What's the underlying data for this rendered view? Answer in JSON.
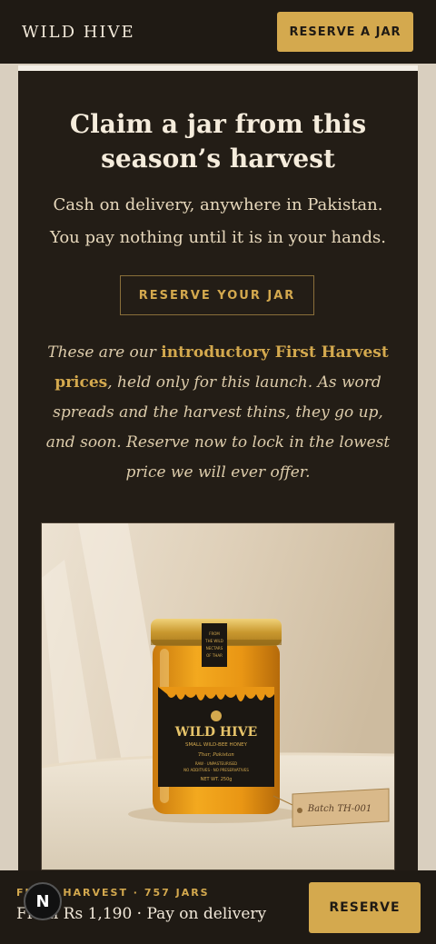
{
  "header": {
    "brand": "WILD HIVE",
    "cta": "RESERVE A JAR"
  },
  "hero": {
    "heading_line1": "Claim a jar from this",
    "heading_line2": "season’s harvest",
    "subtitle": "Cash on delivery, anywhere in Pakistan. You pay nothing until it is in your hands.",
    "button": "RESERVE YOUR JAR",
    "intro_pre": "These are our ",
    "intro_highlight": "introductory First Harvest prices",
    "intro_post": ", held only for this launch. As word spreads and the harvest thins, they go up, and soon. Reserve now to lock in the lowest price we will ever offer."
  },
  "product_image": {
    "lid_label": "FROM THE WILD NECTARS OF THAR",
    "brand": "WILD HIVE",
    "subtitle": "SMALL WILD-BEE HONEY",
    "origin": "Thar, Pakistan",
    "features_1": "RAW · UNPASTEURISED",
    "features_2": "NO ADDITIVES · NO PRESERVATIVES",
    "weight": "NET WT. 250g",
    "tag": "Batch TH-001"
  },
  "bottom_bar": {
    "label": "FIRST HARVEST · 757 JARS",
    "price": "From Rs 1,190 · Pay on delivery",
    "button": "RESERVE"
  },
  "badge": {
    "letter": "N"
  },
  "colors": {
    "accent": "#d4a94e",
    "dark": "#231d16",
    "cream": "#f5ecdc"
  }
}
